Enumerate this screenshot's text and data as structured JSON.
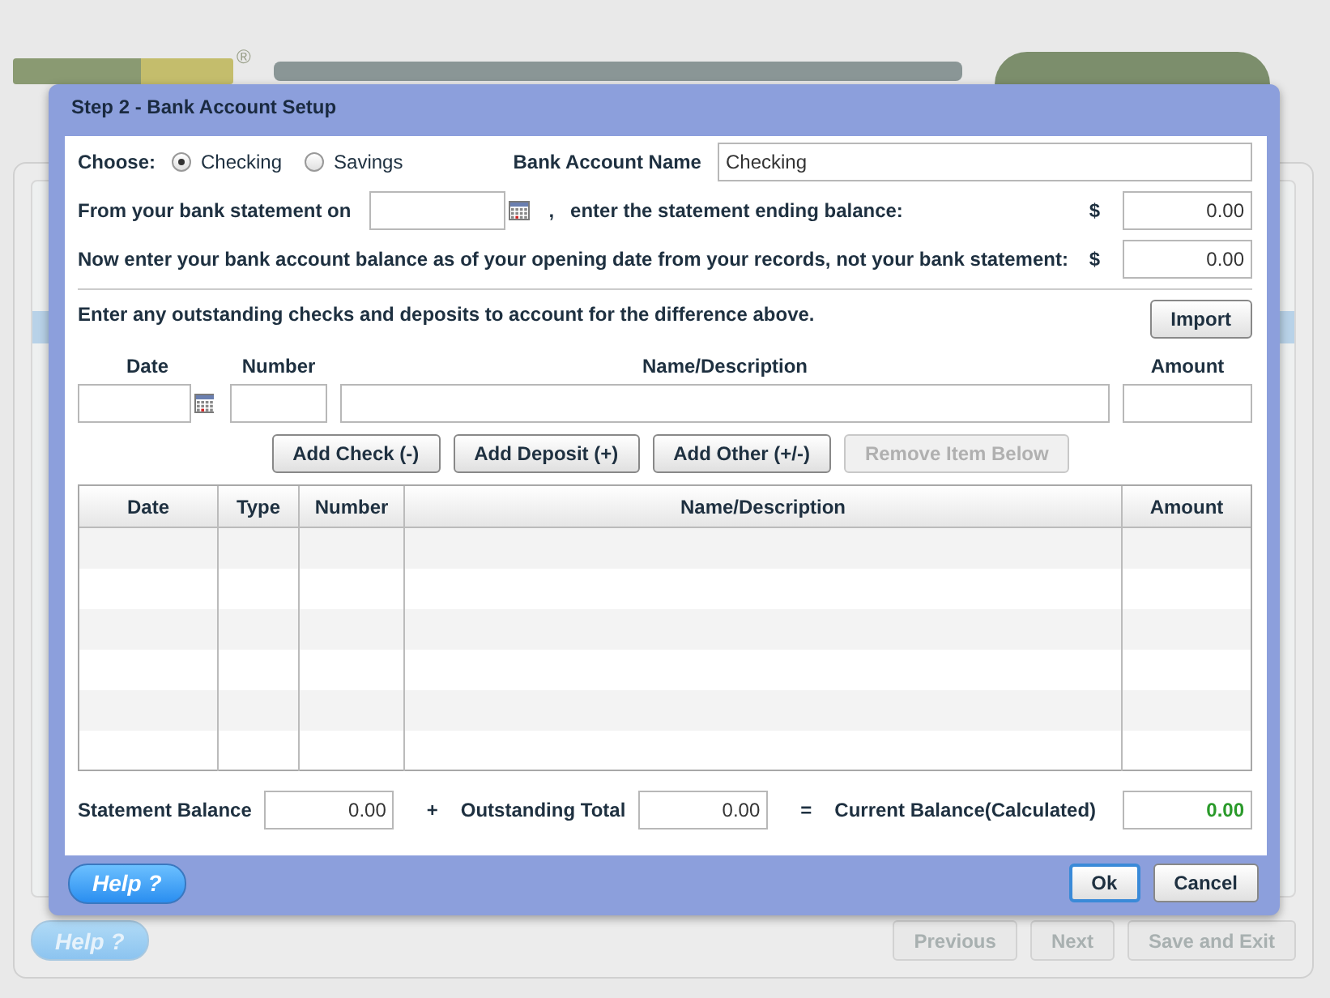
{
  "background": {
    "logo_mark": "®",
    "help_button": "Help ?",
    "buttons": [
      "Previous",
      "Next",
      "Save and Exit"
    ]
  },
  "dialog": {
    "title": "Step 2 - Bank Account Setup",
    "choose_label": "Choose:",
    "account_types": [
      {
        "label": "Checking",
        "selected": true
      },
      {
        "label": "Savings",
        "selected": false
      }
    ],
    "account_name_label": "Bank Account Name",
    "account_name": "Checking",
    "statement_prefix": "From your bank statement on",
    "statement_separator": ",",
    "statement_suffix": "enter the statement ending balance:",
    "statement_currency": "$",
    "statement_balance": "0.00",
    "opening_text": "Now enter your bank account balance as of your opening date from your records, not your bank statement:",
    "opening_currency": "$",
    "opening_balance": "0.00",
    "outstanding_text": "Enter any outstanding checks and deposits to account for the difference above.",
    "import_button": "Import",
    "entry_labels": [
      "Date",
      "Number",
      "Name/Description",
      "Amount"
    ],
    "action_buttons": [
      {
        "label": "Add Check (-)",
        "disabled": false
      },
      {
        "label": "Add Deposit (+)",
        "disabled": false
      },
      {
        "label": "Add Other (+/-)",
        "disabled": false
      },
      {
        "label": "Remove Item Below",
        "disabled": true
      }
    ],
    "table": {
      "columns": [
        "Date",
        "Type",
        "Number",
        "Name/Description",
        "Amount"
      ]
    },
    "totals": {
      "statement_label": "Statement Balance",
      "statement_value": "0.00",
      "plus": "+",
      "outstanding_label": "Outstanding Total",
      "outstanding_value": "0.00",
      "equals": "=",
      "current_label": "Current Balance(Calculated)",
      "current_value": "0.00"
    },
    "help_button": "Help ?",
    "buttons": [
      {
        "label": "Ok",
        "default": true
      },
      {
        "label": "Cancel",
        "default": false
      }
    ]
  }
}
